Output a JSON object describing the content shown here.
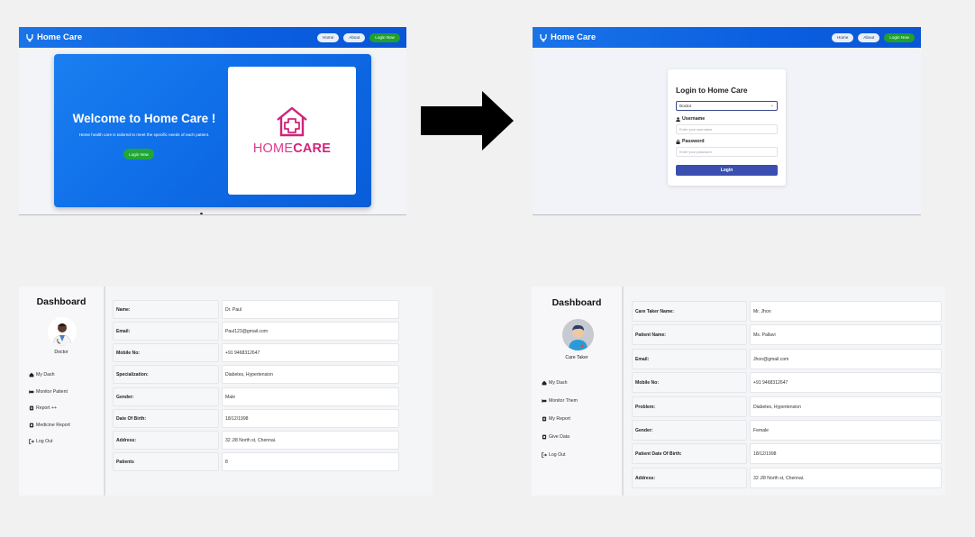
{
  "landing": {
    "brand": "Home Care",
    "nav": [
      "Home",
      "About",
      "Login Now"
    ],
    "hero_title": "Welcome to Home Care !",
    "hero_text": "Home health care is tailored to meet the specific needs of each patient.",
    "hero_button": "Login Now",
    "logo_word_home": "HOME",
    "logo_word_care": "CARE"
  },
  "login": {
    "brand": "Home Care",
    "nav": [
      "Home",
      "About",
      "Login Now"
    ],
    "title": "Login to Home Care",
    "role_selected": "Doctor",
    "username_label": "Username",
    "username_placeholder": "Enter your username",
    "password_label": "Password",
    "password_placeholder": "Enter your password",
    "button": "Login"
  },
  "doctor_dashboard": {
    "title": "Dashboard",
    "role": "Doctor",
    "menu": [
      "My Dash",
      "Monitor Patient",
      "Report ++",
      "Medicine Report",
      "Log Out"
    ],
    "fields": [
      {
        "label": "Name:",
        "value": "Dr. Paul"
      },
      {
        "label": "Email:",
        "value": "Paul123@gmail.com"
      },
      {
        "label": "Mobile No:",
        "value": "+91 9468312647"
      },
      {
        "label": "Specialization:",
        "value": "Diabetes, Hypertension"
      },
      {
        "label": "Gender:",
        "value": "Male"
      },
      {
        "label": "Date Of Birth:",
        "value": "18/12/1998"
      },
      {
        "label": "Address:",
        "value": "32 J/8 North st, Chennai."
      },
      {
        "label": "Patients",
        "value": "8"
      }
    ]
  },
  "caretaker_dashboard": {
    "title": "Dashboard",
    "role": "Care Taker",
    "menu": [
      "My Dash",
      "Monitor Them",
      "My Report",
      "Give Data",
      "Log Out"
    ],
    "fields": [
      {
        "label": "Care Taker Name:",
        "value": "Mr. Jhon"
      },
      {
        "label": "Patient Name:",
        "value": "Ms. Pallavi"
      },
      {
        "label": "Email:",
        "value": "Jhon@gmail.com"
      },
      {
        "label": "Mobile No:",
        "value": "+91 9468312647"
      },
      {
        "label": "Problem:",
        "value": "Diabetes, Hypertension"
      },
      {
        "label": "Gender:",
        "value": "Female"
      },
      {
        "label": "Patient Date Of Birth:",
        "value": "18/12/1998"
      },
      {
        "label": "Address:",
        "value": "32 J/8 North st, Chennai."
      }
    ]
  },
  "colors": {
    "navbar": "#0a5fe0",
    "hero": "#0f6ee8",
    "accent_green": "#21a637",
    "login_button": "#3a4fb0",
    "logo_pink": "#d1237a"
  }
}
